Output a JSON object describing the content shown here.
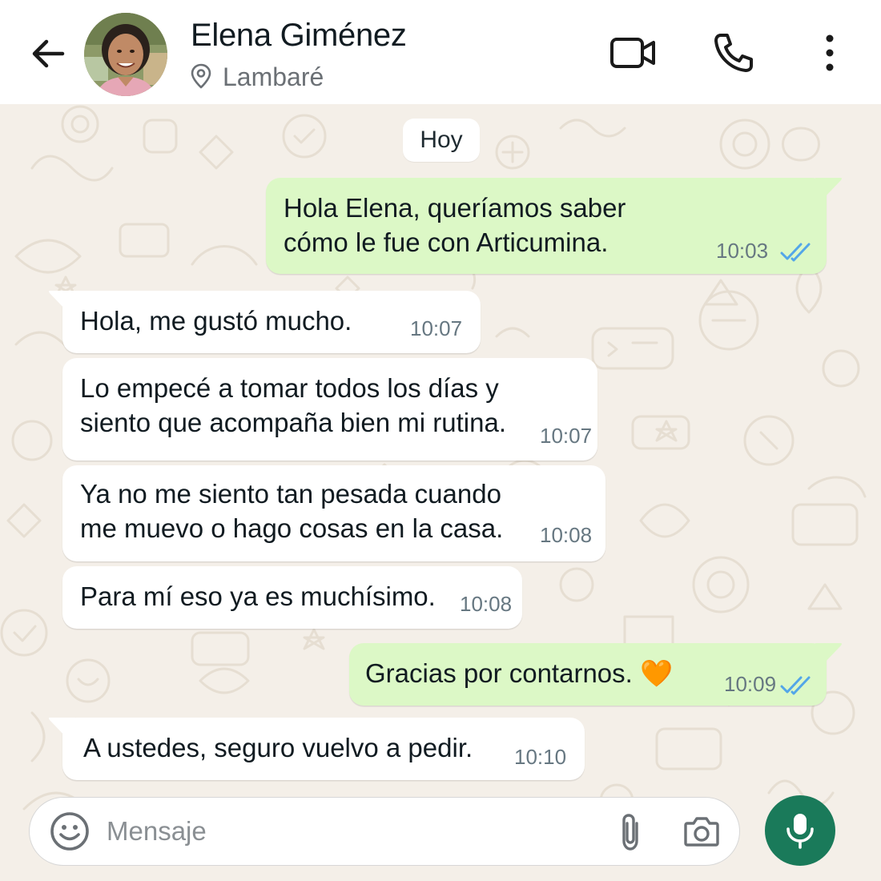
{
  "header": {
    "contact_name": "Elena Giménez",
    "location": "Lambaré",
    "icons": [
      "back-arrow-icon",
      "location-pin-icon",
      "video-call-icon",
      "phone-call-icon",
      "more-options-icon"
    ]
  },
  "chat": {
    "date_label": "Hoy",
    "messages": [
      {
        "direction": "out",
        "lines": [
          "Hola Elena, queríamos saber",
          "cómo le fue con Articumina."
        ],
        "time": "10:03",
        "status": "read"
      },
      {
        "direction": "in",
        "lines": [
          "Hola, me gustó mucho."
        ],
        "time": "10:07"
      },
      {
        "direction": "in",
        "lines": [
          "Lo empecé a tomar todos los días y",
          "siento que acompaña bien mi rutina."
        ],
        "time": "10:07"
      },
      {
        "direction": "in",
        "lines": [
          "Ya no me siento tan pesada cuando",
          "me muevo o hago cosas en la casa."
        ],
        "time": "10:08"
      },
      {
        "direction": "in",
        "lines": [
          "Para mí eso ya es muchísimo."
        ],
        "time": "10:08"
      },
      {
        "direction": "out",
        "lines": [
          "Gracias por contarnos. 🧡"
        ],
        "time": "10:09",
        "status": "read"
      },
      {
        "direction": "in",
        "lines": [
          "A ustedes, seguro vuelvo a pedir."
        ],
        "time": "10:10"
      }
    ]
  },
  "composer": {
    "placeholder": "Mensaje",
    "value": "",
    "icons": [
      "emoji-icon",
      "attach-icon",
      "camera-icon",
      "mic-icon"
    ]
  },
  "colors": {
    "header_bg": "#ffffff",
    "chat_bg": "#f4efe8",
    "incoming_bubble": "#ffffff",
    "outgoing_bubble": "#dcf8c6",
    "read_ticks": "#53a6e8",
    "mic_button": "#1a7a5a"
  }
}
